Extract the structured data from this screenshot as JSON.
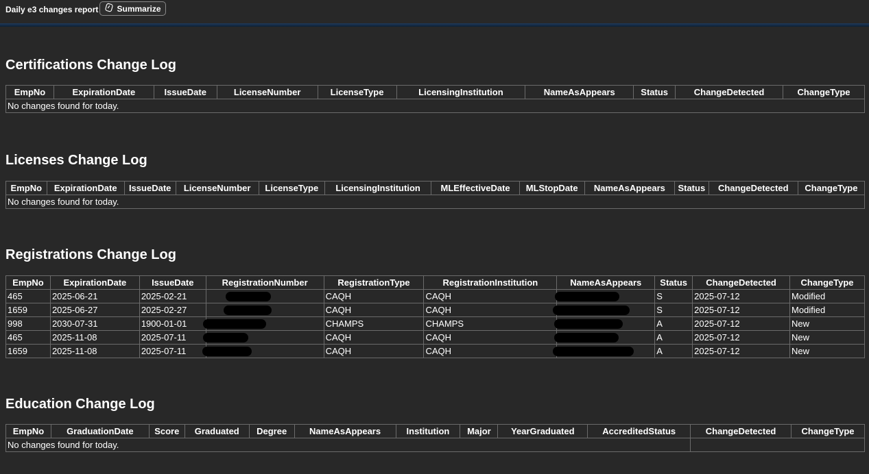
{
  "header": {
    "title": "Daily e3 changes report",
    "summarize_label": "Summarize"
  },
  "certifications": {
    "title": "Certifications Change Log",
    "columns": [
      "EmpNo",
      "ExpirationDate",
      "IssueDate",
      "LicenseNumber",
      "LicenseType",
      "LicensingInstitution",
      "NameAsAppears",
      "Status",
      "ChangeDetected",
      "ChangeType"
    ],
    "empty_message": "No changes found for today."
  },
  "licenses": {
    "title": "Licenses Change Log",
    "columns": [
      "EmpNo",
      "ExpirationDate",
      "IssueDate",
      "LicenseNumber",
      "LicenseType",
      "LicensingInstitution",
      "MLEffectiveDate",
      "MLStopDate",
      "NameAsAppears",
      "Status",
      "ChangeDetected",
      "ChangeType"
    ],
    "empty_message": "No changes found for today."
  },
  "registrations": {
    "title": "Registrations Change Log",
    "columns": [
      "EmpNo",
      "ExpirationDate",
      "IssueDate",
      "RegistrationNumber",
      "RegistrationType",
      "RegistrationInstitution",
      "NameAsAppears",
      "Status",
      "ChangeDetected",
      "ChangeType"
    ],
    "rows": [
      {
        "emp_no": "465",
        "expiration": "2025-06-21",
        "issue": "2025-02-21",
        "reg_type": "CAQH",
        "institution": "CAQH",
        "status": "S",
        "change_detected": "2025-07-12",
        "change_type": "Modified"
      },
      {
        "emp_no": "1659",
        "expiration": "2025-06-27",
        "issue": "2025-02-27",
        "reg_type": "CAQH",
        "institution": "CAQH",
        "status": "S",
        "change_detected": "2025-07-12",
        "change_type": "Modified"
      },
      {
        "emp_no": "998",
        "expiration": "2030-07-31",
        "issue": "1900-01-01",
        "reg_type": "CHAMPS",
        "institution": "CHAMPS",
        "status": "A",
        "change_detected": "2025-07-12",
        "change_type": "New"
      },
      {
        "emp_no": "465",
        "expiration": "2025-11-08",
        "issue": "2025-07-11",
        "reg_type": "CAQH",
        "institution": "CAQH",
        "status": "A",
        "change_detected": "2025-07-12",
        "change_type": "New"
      },
      {
        "emp_no": "1659",
        "expiration": "2025-11-08",
        "issue": "2025-07-11",
        "reg_type": "CAQH",
        "institution": "CAQH",
        "status": "A",
        "change_detected": "2025-07-12",
        "change_type": "New"
      }
    ]
  },
  "education": {
    "title": "Education Change Log",
    "columns": [
      "EmpNo",
      "GraduationDate",
      "Score",
      "Graduated",
      "Degree",
      "NameAsAppears",
      "Institution",
      "Major",
      "YearGraduated",
      "AccreditedStatus",
      "ChangeDetected",
      "ChangeType"
    ],
    "empty_message": "No changes found for today."
  },
  "colors": {
    "background": "#282828",
    "border": "#6b6b6b",
    "text": "#ffffff",
    "redaction": "#000000"
  }
}
